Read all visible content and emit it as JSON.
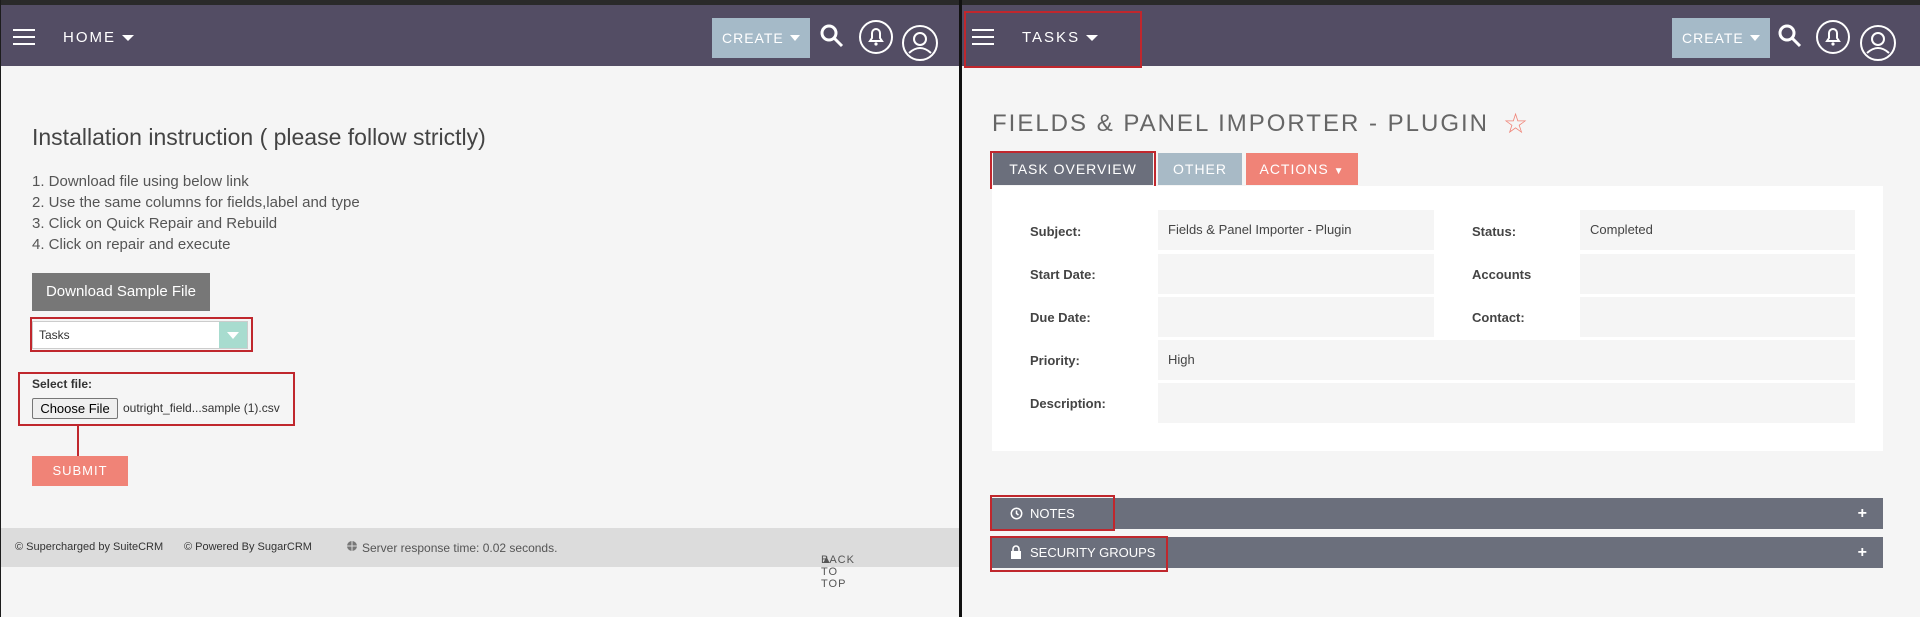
{
  "left": {
    "nav": {
      "label": "HOME",
      "create": "CREATE"
    },
    "heading": "Installation instruction ( please follow strictly)",
    "steps": [
      "1. Download file using below link",
      "2. Use the same columns for fields,label and type",
      "3. Click on Quick Repair and Rebuild",
      "4. Click on repair and execute"
    ],
    "download_button": "Download Sample File",
    "module_select": "Tasks",
    "select_file_label": "Select file:",
    "choose_file_button": "Choose File",
    "file_name": "outright_field...sample (1).csv",
    "submit_button": "SUBMIT",
    "footer": {
      "suitecrm": "© Supercharged by SuiteCRM",
      "sugarcrm": "© Powered By SugarCRM",
      "response": "Server response time: 0.02 seconds.",
      "back_to_top": "BACK TO TOP"
    }
  },
  "right": {
    "nav": {
      "label": "TASKS",
      "create": "CREATE"
    },
    "title": "FIELDS & PANEL IMPORTER - PLUGIN",
    "tabs": {
      "overview": "TASK OVERVIEW",
      "other": "OTHER",
      "actions": "ACTIONS"
    },
    "fields": {
      "subject_label": "Subject:",
      "subject_value": "Fields & Panel Importer - Plugin",
      "status_label": "Status:",
      "status_value": "Completed",
      "start_label": "Start Date:",
      "start_value": "",
      "accounts_label": "Accounts",
      "accounts_value": "",
      "due_label": "Due Date:",
      "due_value": "",
      "contact_label": "Contact:",
      "contact_value": "",
      "priority_label": "Priority:",
      "priority_value": "High",
      "description_label": "Description:",
      "description_value": ""
    },
    "panels": {
      "notes": "NOTES",
      "security": "SECURITY GROUPS"
    }
  },
  "colors": {
    "navbar": "#534d64",
    "create": "#a5bac8",
    "accent": "#f08377",
    "highlight": "#c0272d"
  }
}
